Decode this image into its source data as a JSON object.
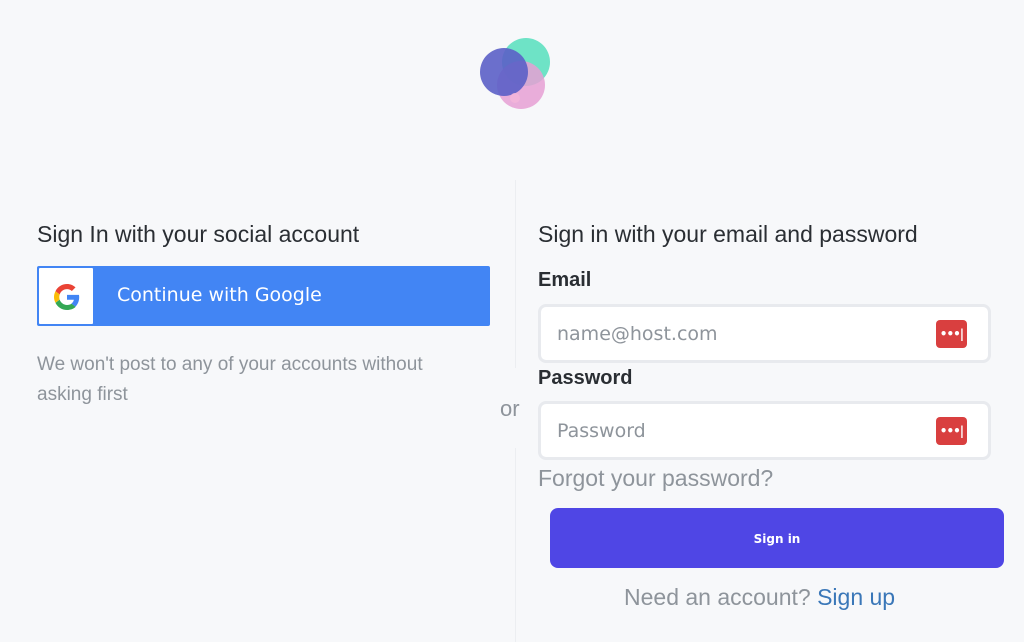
{
  "logo": {
    "name": "app-logo",
    "colors": [
      "#5b5fc7",
      "#5ee0c0",
      "#e6a0d4"
    ]
  },
  "divider": {
    "or_text": "or"
  },
  "social": {
    "heading": "Sign In with your social account",
    "google_button_label": "Continue with Google",
    "google_icon": "google-g-icon",
    "privacy_note": "We won't post to any of your accounts without asking first",
    "button_color": "#4285f4"
  },
  "credentials": {
    "heading": "Sign in with your email and password",
    "email_label": "Email",
    "email_placeholder": "name@host.com",
    "email_value": "",
    "password_label": "Password",
    "password_placeholder": "Password",
    "password_value": "",
    "password_manager_icon": "password-manager-icon",
    "password_manager_glyph": "•••|",
    "forgot_link": "Forgot your password?",
    "signin_button": "Sign in",
    "signin_color": "#4f46e5",
    "signup_prompt": "Need an account?",
    "signup_link": "Sign up"
  }
}
